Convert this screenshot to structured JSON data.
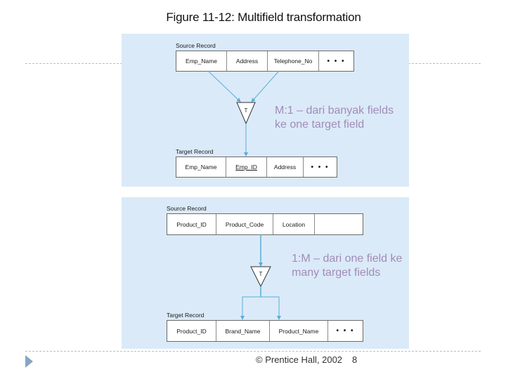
{
  "title": "Figure 11-12: Multifield transformation",
  "diagrams": [
    {
      "id": "many-to-one",
      "source": {
        "label": "Source Record",
        "fields": [
          "Emp_Name",
          "Address",
          "Telephone_No",
          "• • •"
        ]
      },
      "transform_symbol": "T",
      "target": {
        "label": "Target Record",
        "fields": [
          "Emp_Name",
          "Emp_ID",
          "Address",
          "• • •"
        ],
        "underlined_field": "Emp_ID"
      },
      "note_lines": [
        "M:1 – dari banyak fields",
        "ke one target field"
      ]
    },
    {
      "id": "one-to-many",
      "source": {
        "label": "Source Record",
        "fields": [
          "Product_ID",
          "Product_Code",
          "Location",
          ""
        ]
      },
      "transform_symbol": "T",
      "target": {
        "label": "Target Record",
        "fields": [
          "Product_ID",
          "Brand_Name",
          "Product_Name",
          "• • •"
        ]
      },
      "note_lines": [
        "1:M – dari one field ke",
        "many target fields"
      ]
    }
  ],
  "colors": {
    "panel": "#dbeaf8",
    "arrow": "#5aaed6",
    "note": "#a08cb8"
  },
  "footer": {
    "copyright": "© Prentice Hall, 2002",
    "page": "8"
  }
}
